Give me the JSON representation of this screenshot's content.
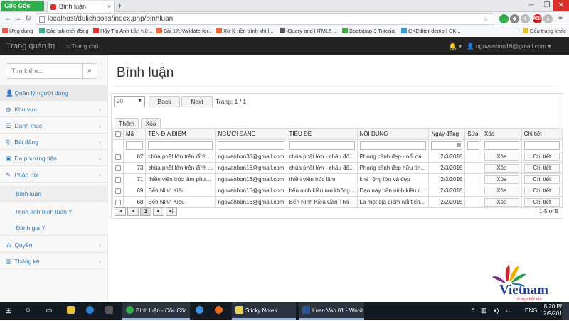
{
  "browser": {
    "brand": "Cốc Cốc",
    "tab_title": "Bình luận",
    "url": "localhost/dulichboss/index.php/binhluan",
    "bookmarks": [
      {
        "label": "Ứng dụng",
        "color": "#e55"
      },
      {
        "label": "Các tab mới đóng",
        "color": "#4a8"
      },
      {
        "label": "Hãy Tin Anh Lần Nữ...",
        "color": "#d33"
      },
      {
        "label": "Bài 17: Validate for...",
        "color": "#e63"
      },
      {
        "label": "Xử lý tiền trình khi l...",
        "color": "#e63"
      },
      {
        "label": "jQuery and HTML5 ...",
        "color": "#555"
      },
      {
        "label": "Bootstrap 3 Tutorial",
        "color": "#4a4"
      },
      {
        "label": "CKEditor demo | CK...",
        "color": "#39c"
      },
      {
        "label": "Dấu trang khác",
        "color": "#e8c040"
      }
    ]
  },
  "navbar": {
    "title": "Trang quản trị",
    "home": "Trang chủ",
    "user": "ngovanbon16@gmail.com"
  },
  "sidebar": {
    "search_placeholder": "Tìm kiếm...",
    "items": [
      {
        "label": "Quản lý người dùng",
        "icon": "user-icon",
        "glyph": "👤",
        "chevron": ""
      },
      {
        "label": "Khu vực",
        "icon": "globe-icon",
        "glyph": "◍",
        "chevron": "‹"
      },
      {
        "label": "Danh mục",
        "icon": "list-icon",
        "glyph": "☰",
        "chevron": "‹"
      },
      {
        "label": "Bài đăng",
        "icon": "map-marker-icon",
        "glyph": "⚲",
        "chevron": "‹"
      },
      {
        "label": "Đa phương tiện",
        "icon": "image-icon",
        "glyph": "▣",
        "chevron": "‹"
      },
      {
        "label": "Phản hồi",
        "icon": "comments-icon",
        "glyph": "✎",
        "chevron": "‹"
      },
      {
        "label": "Bình luận",
        "icon": "",
        "glyph": "",
        "chevron": ""
      },
      {
        "label": "Hình ảnh bình luận Y",
        "icon": "",
        "glyph": "",
        "chevron": ""
      },
      {
        "label": "Đánh giá Y",
        "icon": "",
        "glyph": "",
        "chevron": ""
      },
      {
        "label": "Quyền",
        "icon": "sitemap-icon",
        "glyph": "⁂",
        "chevron": "‹"
      },
      {
        "label": "Thống kê",
        "icon": "chart-icon",
        "glyph": "▥",
        "chevron": "‹"
      }
    ]
  },
  "main": {
    "title": "Bình luận",
    "page_size": "20",
    "back_label": "Back",
    "next_label": "Next",
    "page_info": "Trang: 1 / 1",
    "add_label": "Thêm",
    "delete_label": "Xóa",
    "columns": [
      "Mã",
      "TÊN ĐỊA ĐIỂM",
      "NGƯỜI ĐĂNG",
      "TIÊU ĐỀ",
      "NỘI DUNG",
      "Ngày đăng",
      "Sửa",
      "Xóa",
      "Chi tiết"
    ],
    "row_delete_label": "Xóa",
    "row_detail_label": "Chi tiết",
    "rows": [
      {
        "id": "87",
        "place": "chùa phật lớn trên đỉnh ...",
        "user": "ngovanbon38@gmail.com",
        "title": "chùa phật lớn - châu đố...",
        "content": "Phong cảnh đẹp - nổi da...",
        "date": "2/3/2016"
      },
      {
        "id": "73",
        "place": "chùa phật lớn trên đỉnh ...",
        "user": "ngovanbon16@gmail.com",
        "title": "chùa phật lớn - châu đố...",
        "content": "Phong cảnh đẹp hữu tìn...",
        "date": "2/3/2016"
      },
      {
        "id": "71",
        "place": "thiền viện trúc lâm phư...",
        "user": "ngovanbon16@gmail.com",
        "title": "thiền viện trúc lâm",
        "content": "khá rộng lớn và đẹp",
        "date": "2/3/2016"
      },
      {
        "id": "69",
        "place": "Bến Ninh Kiều",
        "user": "ngovanbon16@gmail.com",
        "title": "bến ninh kiều nơi không...",
        "content": "Dạo này bến ninh kiều c...",
        "date": "2/3/2016"
      },
      {
        "id": "68",
        "place": "Bến Ninh Kiều",
        "user": "ngovanbon16@gmail.com",
        "title": "Bến Ninh Kiều Cần Thơ",
        "content": "Là một địa điểm nổi tiến...",
        "date": "2/2/2016"
      }
    ],
    "current_page": "1",
    "row_count": "1-5 of 5"
  },
  "taskbar": {
    "apps": [
      {
        "label": "Bình luận - Cốc Cốc",
        "color": "#2fae4a"
      },
      {
        "label": "Sticky Notes",
        "color": "#e8d34a"
      },
      {
        "label": "Luan Van 01 - Word",
        "color": "#2b579a"
      }
    ],
    "lang": "ENG",
    "time": "8:20 PM",
    "date": "2/9/2016"
  },
  "logo": {
    "text": "Vietnam",
    "tagline": "Vẻ đẹp bất tận"
  }
}
